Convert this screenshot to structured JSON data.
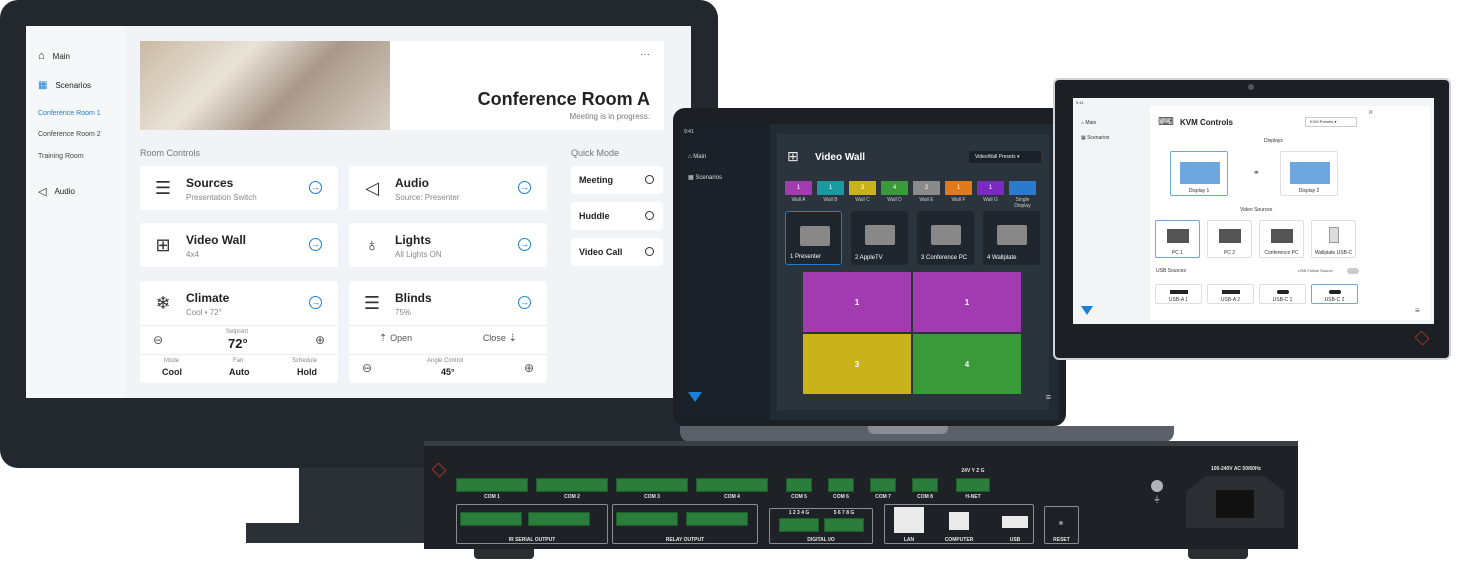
{
  "monitor": {
    "nav": {
      "main": "Main",
      "scenarios": "Scenarios",
      "rooms": [
        "Conference Room 1",
        "Conference Room 2",
        "Training Room"
      ],
      "audio": "Audio"
    },
    "header": {
      "title": "Conference Room A",
      "subtitle": "Meeting is in progress.",
      "menu": "···"
    },
    "room_controls_label": "Room Controls",
    "quick_mode_label": "Quick Mode",
    "cards": {
      "sources": {
        "title": "Sources",
        "sub": "Presentation Switch"
      },
      "audio": {
        "title": "Audio",
        "sub": "Source: Presenter"
      },
      "video_wall": {
        "title": "Video Wall",
        "sub": "4x4"
      },
      "lights": {
        "title": "Lights",
        "sub": "All Lights ON"
      },
      "climate": {
        "title": "Climate",
        "sub": "Cool • 72°",
        "setpoint_label": "Setpoint",
        "setpoint": "72°",
        "mode_label": "Mode",
        "mode": "Cool",
        "fan_label": "Fan",
        "fan": "Auto",
        "schedule_label": "Schedule",
        "schedule": "Hold"
      },
      "blinds": {
        "title": "Blinds",
        "sub": "75%",
        "open": "Open",
        "close": "Close",
        "angle_label": "Angle Control",
        "angle": "45°"
      }
    },
    "quick_modes": [
      "Meeting",
      "Huddle",
      "Video Call"
    ]
  },
  "laptop": {
    "time": "9:41",
    "nav": {
      "main": "Main",
      "scenarios": "Scenarios"
    },
    "title": "Video Wall",
    "presets": "VideoWall Presets",
    "strip": [
      {
        "n": "1",
        "label": "Wall A",
        "color": "#a33bb0"
      },
      {
        "n": "1",
        "label": "Wall B",
        "color": "#1a9aa0"
      },
      {
        "n": "3",
        "label": "Wall C",
        "color": "#c9b21a"
      },
      {
        "n": "4",
        "label": "Wall D",
        "color": "#3a9a3a"
      },
      {
        "n": "2",
        "label": "Wall E",
        "color": "#8a8a8a"
      },
      {
        "n": "1",
        "label": "Wall F",
        "color": "#e07a1a"
      },
      {
        "n": "1",
        "label": "Wall G",
        "color": "#7a2ac0"
      },
      {
        "n": "",
        "label": "Single Display",
        "color": "#2a7ad0"
      }
    ],
    "sources": [
      {
        "num": "1",
        "name": "Presenter"
      },
      {
        "num": "2",
        "name": "AppleTV"
      },
      {
        "num": "3",
        "name": "Conference PC"
      },
      {
        "num": "4",
        "name": "Wallplate"
      }
    ],
    "wall": [
      "1",
      "1",
      "3",
      "4"
    ]
  },
  "tablet": {
    "time": "9:41",
    "nav": {
      "main": "Main",
      "scenarios": "Scenarios"
    },
    "title": "KVM Controls",
    "preset": "KVM Presets",
    "displays_label": "Displays",
    "displays": [
      "Display 1",
      "Display 2"
    ],
    "video_sources_label": "Video Sources",
    "video_sources": [
      "PC 1",
      "PC 2",
      "Conference PC",
      "Wallplate USB-C"
    ],
    "usb_sources_label": "USB Sources",
    "usb_follow": "USB Follow Source",
    "usb_sources": [
      "USB-A 1",
      "USB-A 2",
      "USB-C 1",
      "USB-C 2"
    ]
  },
  "device": {
    "com_labels": [
      "COM 1",
      "COM 2",
      "COM 3",
      "COM 4",
      "COM 5",
      "COM 6",
      "COM 7",
      "COM 8"
    ],
    "hnet": "H-NET",
    "hnet_pins": "24V  Y  Z  G",
    "ir_label": "IR SERIAL OUTPUT",
    "relay_label": "RELAY OUTPUT",
    "dio_label": "DIGITAL I/O",
    "dio_pins_a": "1 2 3 4 G",
    "dio_pins_b": "5 6 7 8 G",
    "lan": "LAN",
    "computer": "COMPUTER",
    "usb": "USB",
    "reset": "RESET",
    "power": "100-240V AC 50/60Hz"
  },
  "colors": {
    "accent": "#1a7fd6",
    "terminal": "#2a7d3a"
  }
}
